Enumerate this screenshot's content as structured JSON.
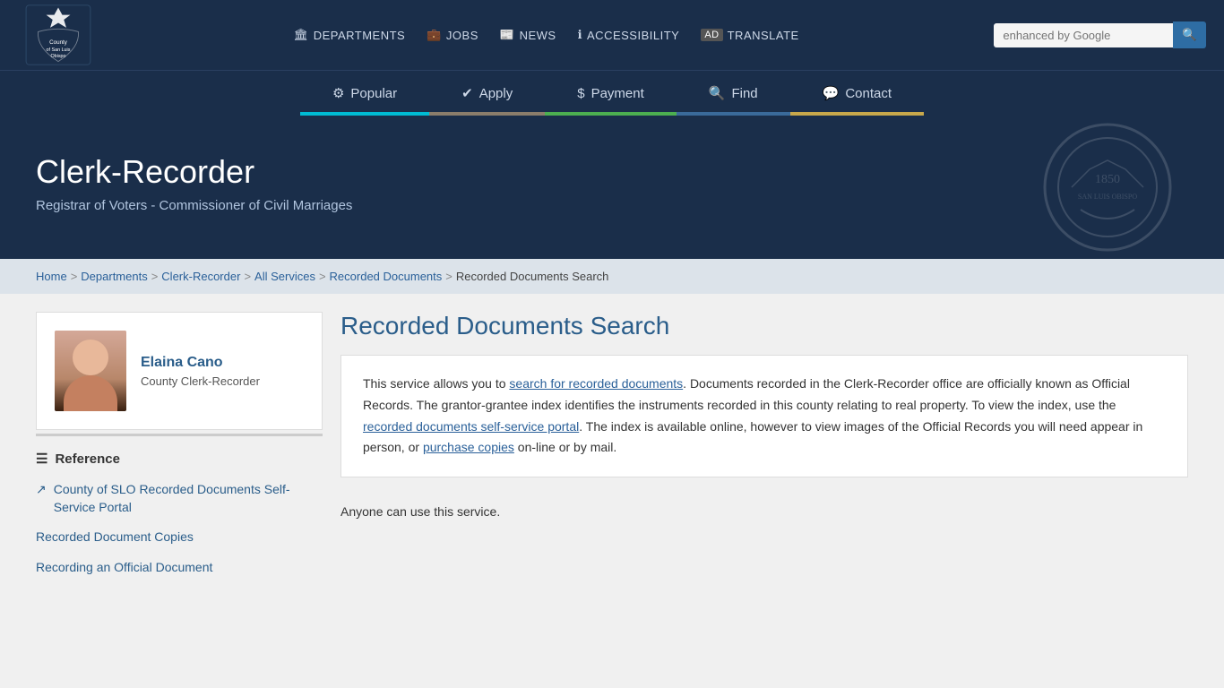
{
  "site": {
    "county_name": "COUNTY OF SAN LUIS OBISPO",
    "logo_text": "County\nof San Luis\nObispo"
  },
  "top_nav": {
    "links": [
      {
        "id": "departments",
        "label": "DEPARTMENTS",
        "icon": "building"
      },
      {
        "id": "jobs",
        "label": "JOBS",
        "icon": "briefcase"
      },
      {
        "id": "news",
        "label": "NEWS",
        "icon": "news"
      },
      {
        "id": "accessibility",
        "label": "ACCESSIBILITY",
        "icon": "accessible"
      },
      {
        "id": "translate",
        "label": "TRANSLATE",
        "icon": "translate"
      }
    ],
    "search_placeholder": "enhanced by Google"
  },
  "main_nav": {
    "items": [
      {
        "id": "popular",
        "label": "Popular",
        "icon": "gear",
        "class": "popular"
      },
      {
        "id": "apply",
        "label": "Apply",
        "icon": "check",
        "class": "apply"
      },
      {
        "id": "payment",
        "label": "Payment",
        "icon": "dollar",
        "class": "payment"
      },
      {
        "id": "find",
        "label": "Find",
        "icon": "search",
        "class": "find"
      },
      {
        "id": "contact",
        "label": "Contact",
        "icon": "chat",
        "class": "contact"
      }
    ]
  },
  "hero": {
    "title": "Clerk-Recorder",
    "subtitle": "Registrar of Voters - Commissioner of Civil Marriages"
  },
  "breadcrumb": {
    "items": [
      {
        "label": "Home",
        "href": "#"
      },
      {
        "label": "Departments",
        "href": "#"
      },
      {
        "label": "Clerk-Recorder",
        "href": "#"
      },
      {
        "label": "All Services",
        "href": "#"
      },
      {
        "label": "Recorded Documents",
        "href": "#"
      },
      {
        "label": "Recorded Documents Search",
        "href": null
      }
    ]
  },
  "sidebar": {
    "staff": {
      "name": "Elaina Cano",
      "title": "County Clerk-Recorder"
    },
    "section_title": "Reference",
    "links": [
      {
        "id": "self-service",
        "label": "County of SLO Recorded Documents Self-Service Portal",
        "href": "#",
        "icon": "external"
      },
      {
        "id": "copies",
        "label": "Recorded Document Copies",
        "href": "#",
        "icon": null
      },
      {
        "id": "recording",
        "label": "Recording an Official Document",
        "href": "#",
        "icon": null
      }
    ]
  },
  "main_content": {
    "page_title": "Recorded Documents Search",
    "info_box": {
      "intro": "This service allows you to ",
      "link1_text": "search for recorded documents",
      "link1_href": "#",
      "body1": ". Documents recorded in the Clerk-Recorder office are officially known as Official Records. The grantor-grantee index identifies the instruments recorded in this county relating to real property. To view the index, use the ",
      "link2_text": "recorded documents self-service portal",
      "link2_href": "#",
      "body2": ". The index is available online, however to view images of the Official Records you will need appear in person, or ",
      "link3_text": "purchase copies",
      "link3_href": "#",
      "body3": " on-line or by mail."
    },
    "anyone_text": "Anyone can use this service."
  }
}
